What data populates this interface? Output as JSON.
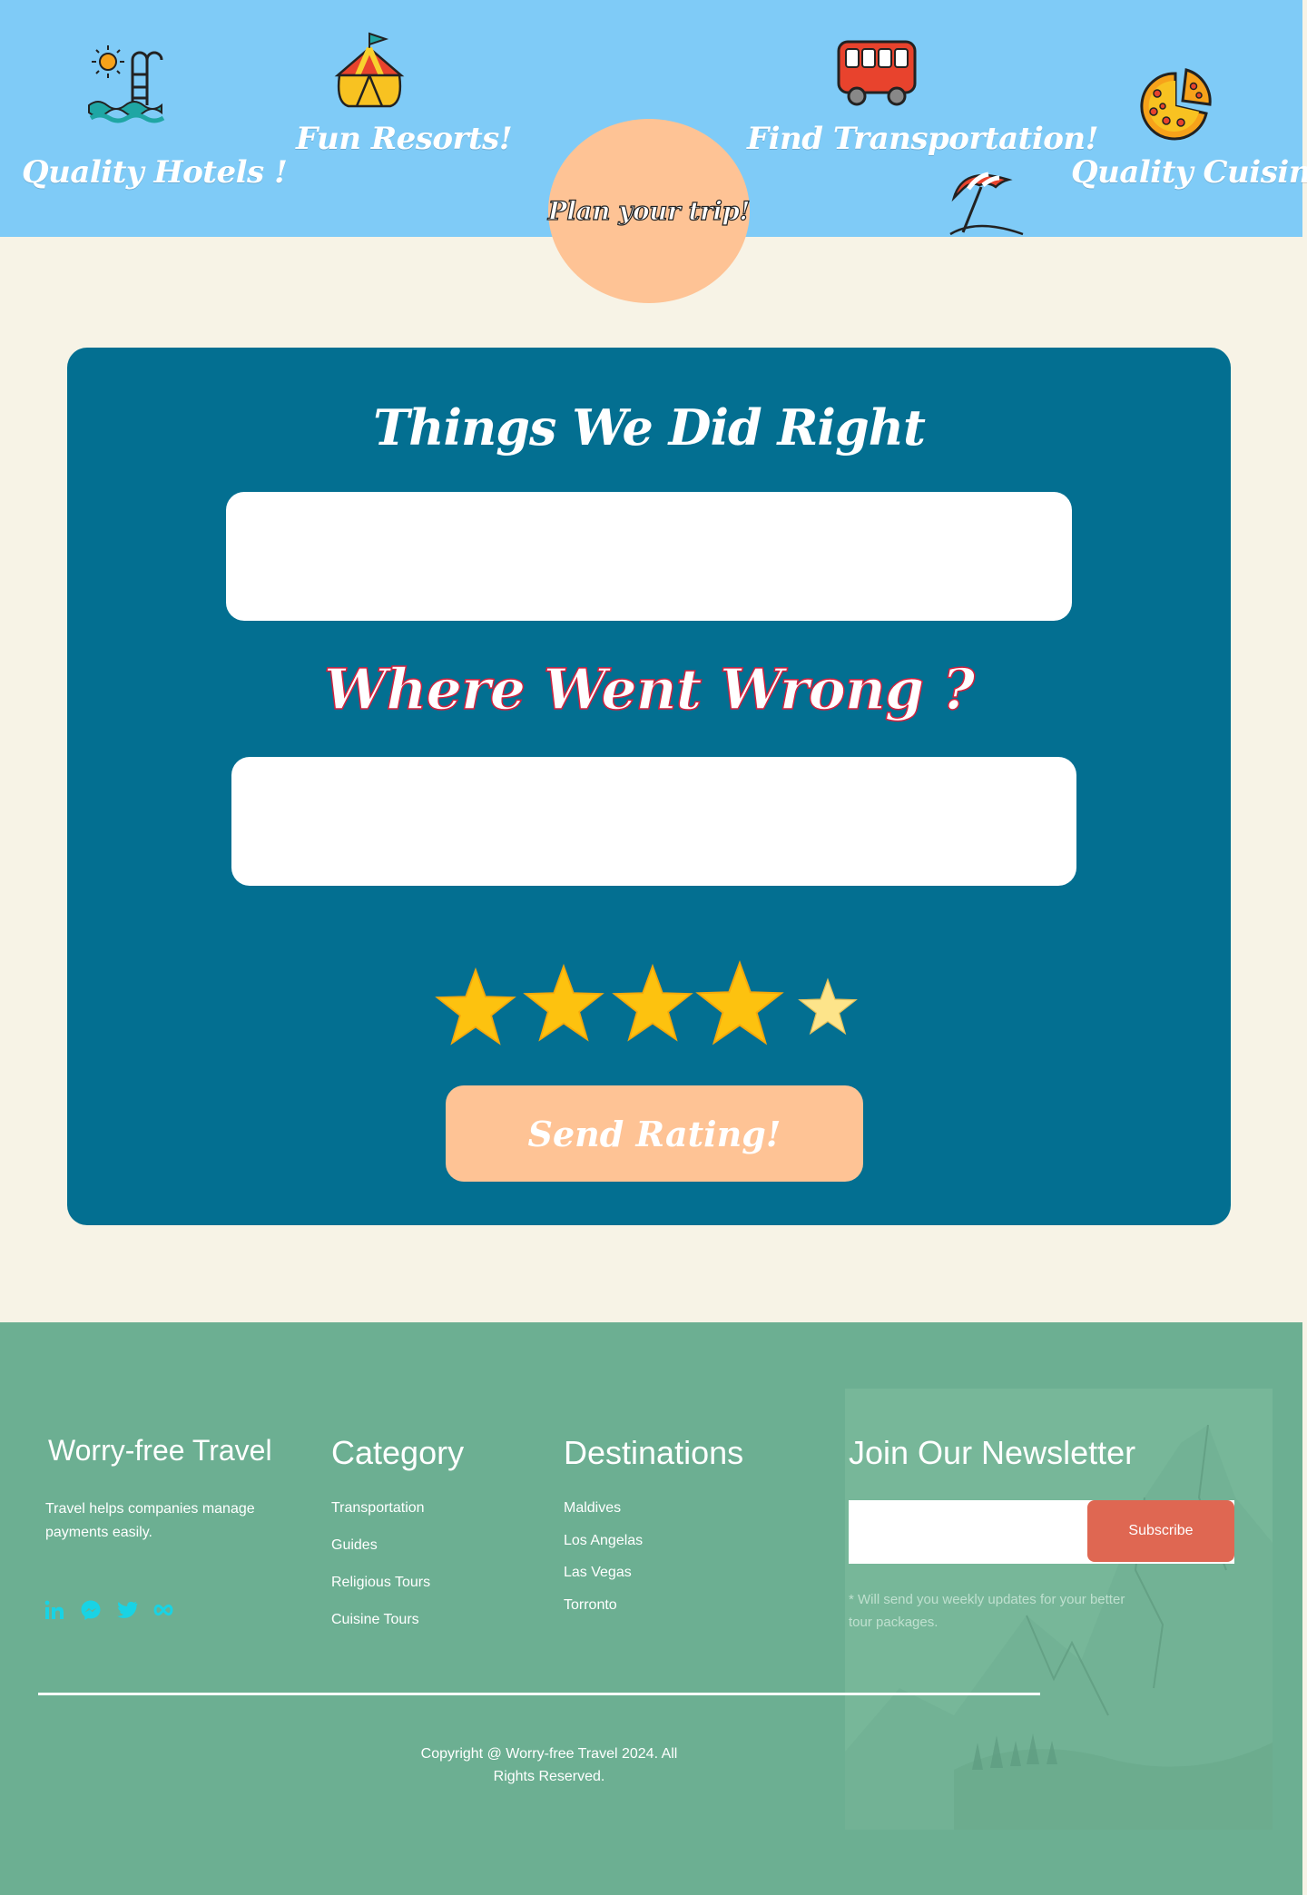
{
  "header": {
    "items": [
      {
        "label": "Quality Hotels !",
        "icon": "pool-ladder-icon"
      },
      {
        "label": "Fun Resorts!",
        "icon": "circus-tent-icon"
      },
      {
        "label": "Find Transportation!",
        "icon": "bus-icon"
      },
      {
        "label": "Quality Cuisine!",
        "icon": "pizza-icon"
      }
    ],
    "beach_icon": "beach-umbrella-icon",
    "plan_button": "Plan your trip!"
  },
  "rating": {
    "title_right": "Things We Did Right",
    "right_value": "",
    "title_wrong": "Where Went Wrong ?",
    "wrong_value": "",
    "stars": {
      "value": 4,
      "max": 5
    },
    "send_button": "Send Rating!"
  },
  "footer": {
    "brand": {
      "title": "Worry-free Travel",
      "description": "Travel helps companies manage payments easily."
    },
    "social_icons": [
      "linkedin-icon",
      "messenger-icon",
      "twitter-icon",
      "infinity-icon"
    ],
    "category": {
      "title": "Category",
      "items": [
        "Transportation",
        "Guides",
        "Religious Tours",
        "Cuisine Tours"
      ]
    },
    "destinations": {
      "title": "Destinations",
      "items": [
        "Maldives",
        "Los Angelas",
        "Las Vegas",
        "Torronto"
      ]
    },
    "newsletter": {
      "title": "Join Our Newsletter",
      "email_value": "",
      "subscribe_button": "Subscribe",
      "note": "*  Will send you weekly updates for your better tour packages."
    },
    "copyright": "Copyright @ Worry-free Travel 2024. All Rights Reserved."
  },
  "colors": {
    "header_bg": "#7fcbf7",
    "page_bg": "#f7f3e6",
    "card_bg": "#036f91",
    "accent_peach": "#fec395",
    "footer_bg": "#6caf92",
    "subscribe_red": "#df6752",
    "star_gold": "#fdc20f",
    "social_cyan": "#19d3e4"
  }
}
